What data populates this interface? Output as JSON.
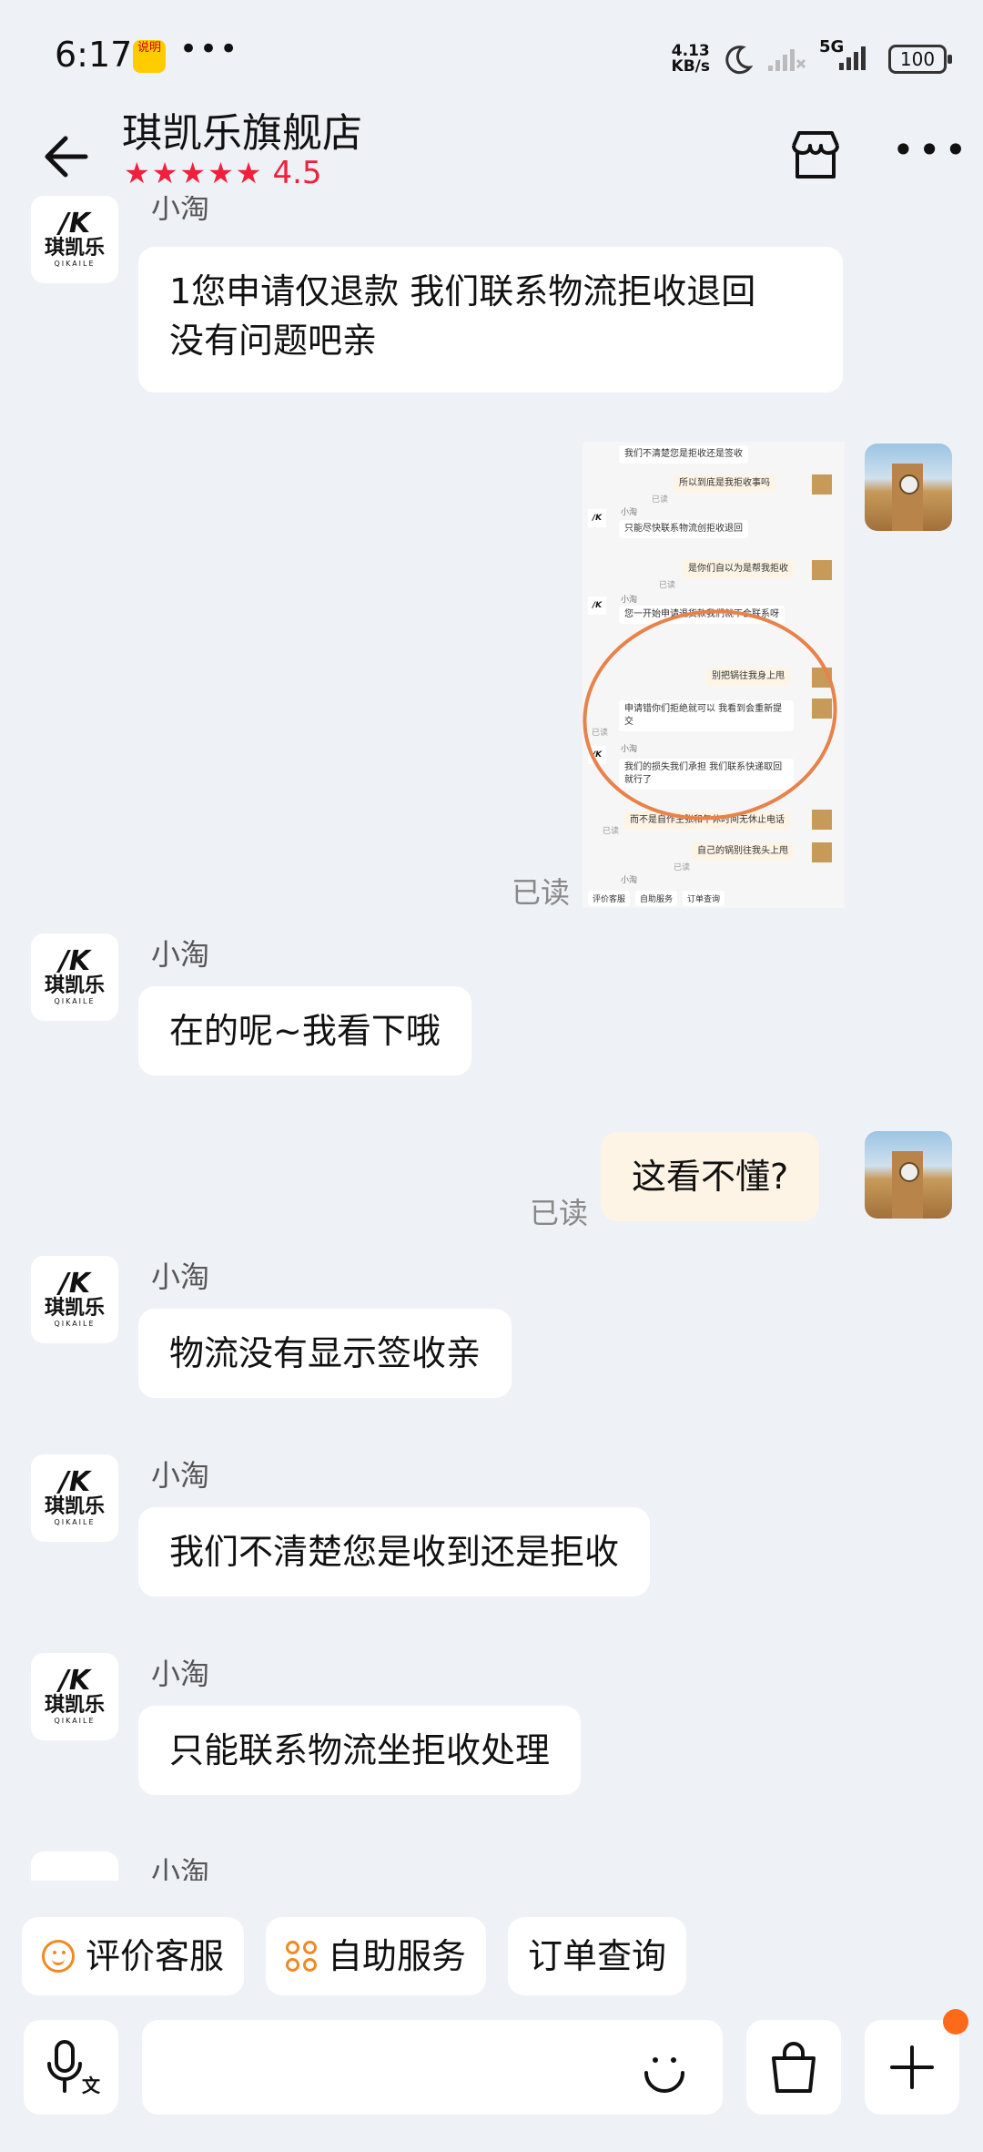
{
  "status_bar": {
    "time": "6:17",
    "app_badge": "说明",
    "dots": "•••",
    "net_speed_value": "4.13",
    "net_speed_unit": "KB/s",
    "network": "5G",
    "battery": "100"
  },
  "header": {
    "title": "琪凯乐旗舰店",
    "stars": "★★★★★",
    "score": "4.5"
  },
  "shop_avatar": {
    "mark": "/K",
    "name": "琪凯乐",
    "en": "QIKAILE"
  },
  "messages": [
    {
      "sender": "小淘",
      "text_line1": "1您申请仅退款 我们联系物流拒收退回",
      "text_line2": "没有问题吧亲"
    },
    {
      "read": "已读"
    },
    {
      "sender": "小淘",
      "text": "在的呢~我看下哦"
    },
    {
      "text": "这看不懂?",
      "read": "已读"
    },
    {
      "sender": "小淘",
      "text": "物流没有显示签收亲"
    },
    {
      "sender": "小淘",
      "text": "我们不清楚您是收到还是拒收"
    },
    {
      "sender": "小淘",
      "text": "只能联系物流坐拒收处理"
    },
    {
      "sender": "小淘"
    }
  ],
  "screenshot": {
    "m1": "我们不清楚您是拒收还是签收",
    "m2": "所以到底是我拒收事吗",
    "read": "已读",
    "name": "小淘",
    "m3": "只能尽快联系物流创拒收退回",
    "m4": "是你们自以为是帮我拒收",
    "m5": "您一开始申请退货款我们就不会联系呀",
    "m6": "别把锅往我身上甩",
    "m7": "申请错你们拒绝就可以 我看到会重新提交",
    "m8": "我们的损失我们承担 我们联系快递取回就行了",
    "m9": "而不是自作主张和午休时间无休止电话",
    "m10": "自己的锅别往我头上甩",
    "bar1": "评价客服",
    "bar2": "自助服务",
    "bar3": "订单查询"
  },
  "quick_actions": {
    "rate": "评价客服",
    "self_service": "自助服务",
    "order_query": "订单查询"
  },
  "input_bar": {
    "voice_label": "文"
  },
  "colors": {
    "accent_red": "#f0203c",
    "orange": "#f08a24",
    "bg": "#eef1f6",
    "my_bubble": "#fdf4e6"
  }
}
